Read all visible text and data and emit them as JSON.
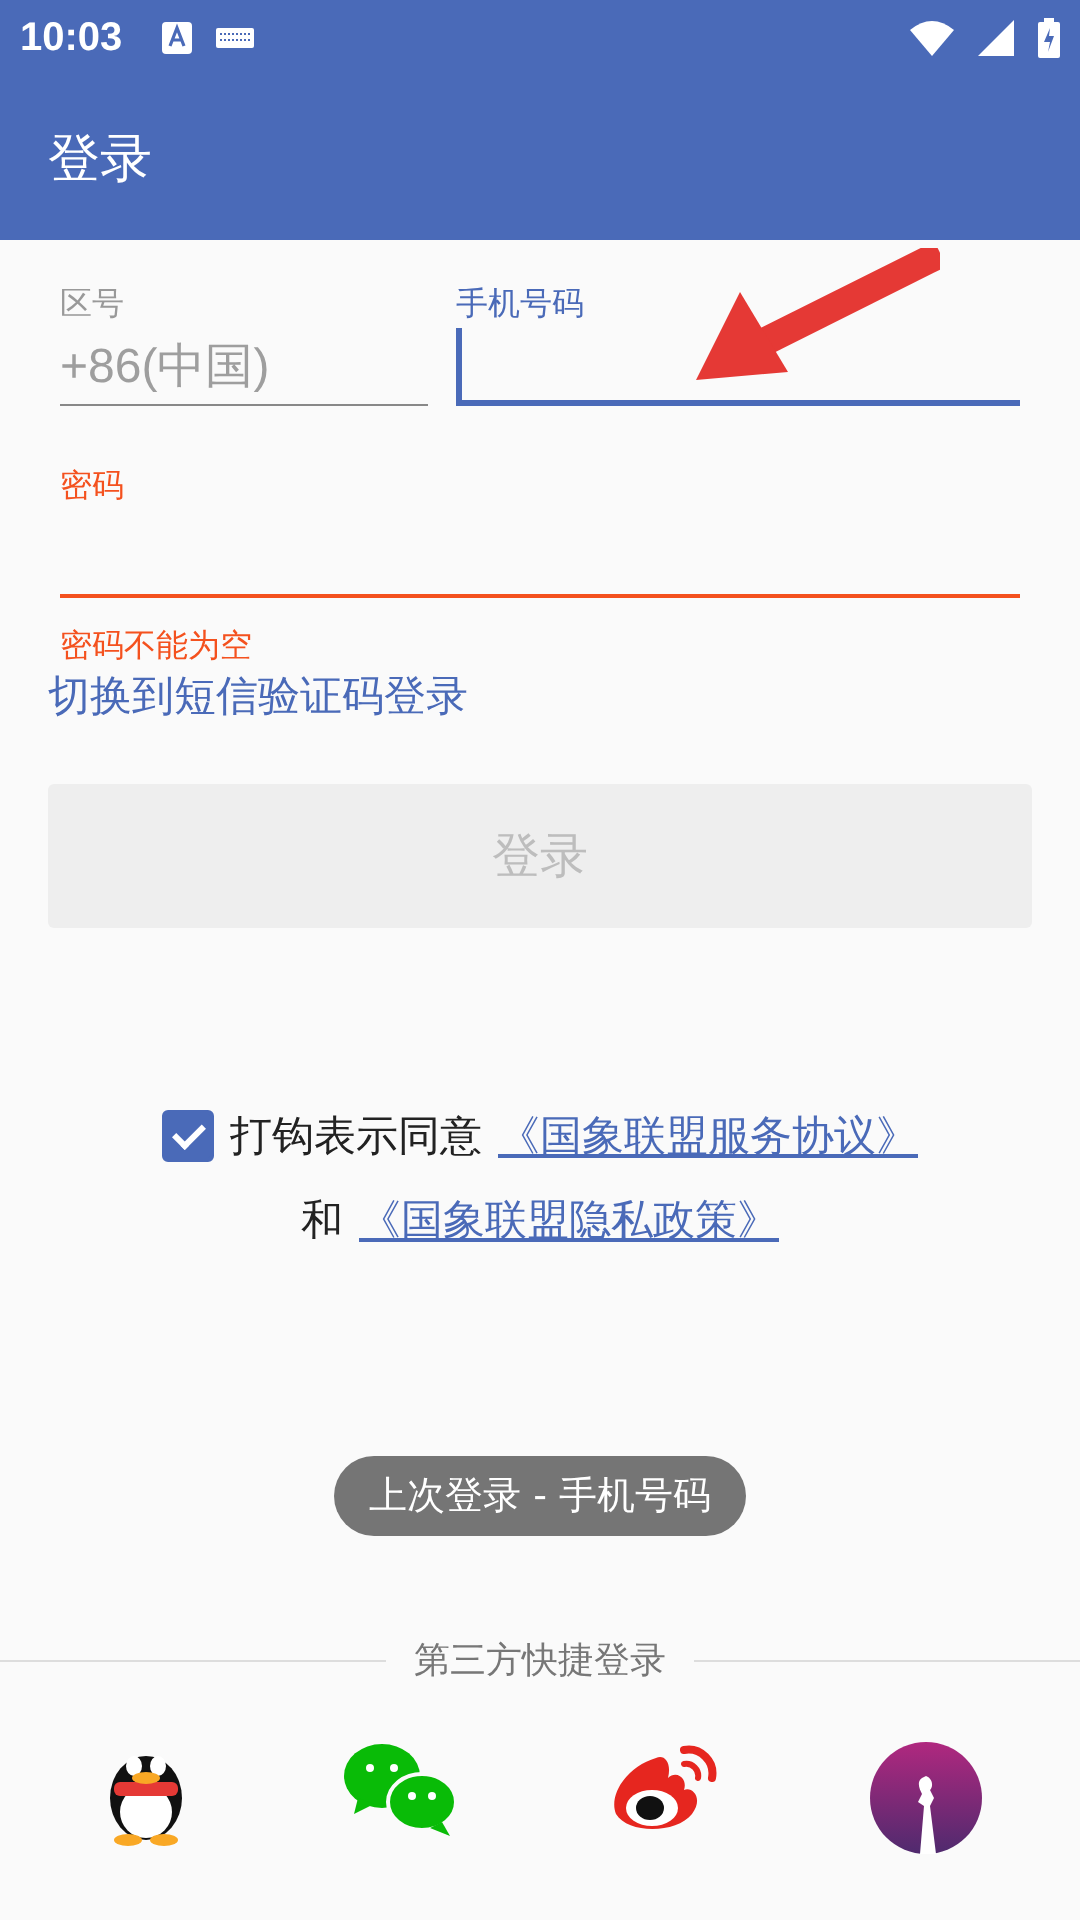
{
  "status_bar": {
    "time": "10:03"
  },
  "app_bar": {
    "title": "登录"
  },
  "form": {
    "area_code": {
      "label": "区号",
      "value": "+86(中国)"
    },
    "phone": {
      "label": "手机号码",
      "focused": true
    },
    "password": {
      "label": "密码",
      "error": "密码不能为空"
    },
    "switch_link": "切换到短信验证码登录",
    "login_button": {
      "label": "登录",
      "disabled": true
    },
    "agreement": {
      "checked": true,
      "text": "打钩表示同意",
      "link1": "《国象联盟服务协议》",
      "joiner": "和",
      "link2": "《国象联盟隐私政策》"
    }
  },
  "last_login_badge": "上次登录 - 手机号码",
  "third_party": {
    "title": "第三方快捷登录",
    "providers": [
      {
        "kind": "penguin"
      },
      {
        "kind": "chat"
      },
      {
        "kind": "eye"
      },
      {
        "kind": "chess"
      }
    ]
  }
}
